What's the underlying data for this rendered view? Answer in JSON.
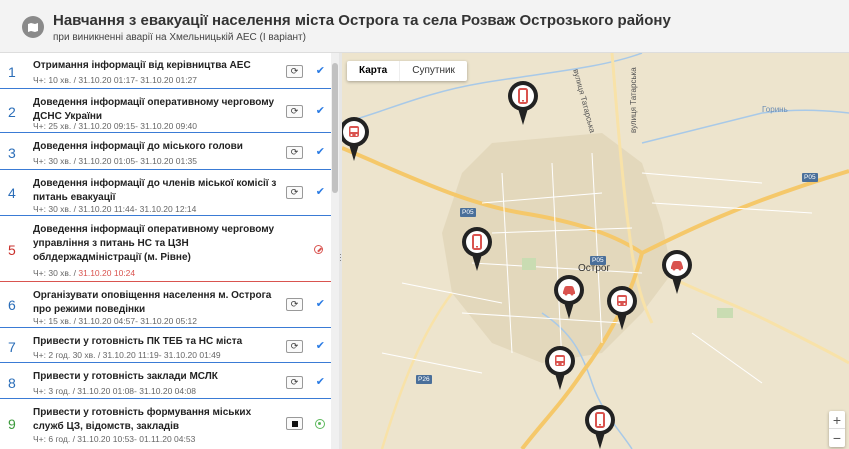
{
  "header": {
    "title": "Навчання з евакуації населення міста Острога та села Розваж Острозького району",
    "subtitle": "при виникненні аварії на Хмельницькій АЕС (І варіант)"
  },
  "tasks": [
    {
      "num": "1",
      "name": "Отримання інформації від керівництва АЕС",
      "meta": "Ч+: 10 хв. / 31.10.20 01:17- 31.10.20 01:27",
      "state": "done"
    },
    {
      "num": "2",
      "name": "Доведення інформації оперативному черговому ДСНС України",
      "meta": "Ч+: 25 хв. / 31.10.20 09:15- 31.10.20 09:40",
      "state": "done"
    },
    {
      "num": "3",
      "name": "Доведення інформації до міського голови",
      "meta": "Ч+: 30 хв. / 31.10.20 01:05- 31.10.20 01:35",
      "state": "done"
    },
    {
      "num": "4",
      "name": "Доведення інформації до членів міської комісії з питань евакуації",
      "meta": "Ч+: 30 хв. / 31.10.20 11:44- 31.10.20 12:14",
      "state": "done"
    },
    {
      "num": "5",
      "name": "Доведення інформації оперативному черговому управління з питань НС та ЦЗН облдержадміністрації (м. Рівне)",
      "meta": "Ч+: 30 хв. / ",
      "meta_late": "31.10.20 10:24",
      "state": "cancelled"
    },
    {
      "num": "6",
      "name": "Організувати оповіщення населення м. Острога про режими поведінки",
      "meta": "Ч+: 15 хв. / 31.10.20 04:57- 31.10.20 05:12",
      "state": "done"
    },
    {
      "num": "7",
      "name": "Привести у готовність ПК ТЕБ та НС міста",
      "meta": "Ч+: 2 год. 30 хв. / 31.10.20 11:19- 31.10.20 01:49",
      "state": "done"
    },
    {
      "num": "8",
      "name": "Привести у готовність заклади МСЛК",
      "meta": "Ч+: 3 год. / 31.10.20 01:08- 31.10.20 04:08",
      "state": "done"
    },
    {
      "num": "9",
      "name": "Привести у готовність формування міських служб ЦЗ, відомств, закладів",
      "meta": "Ч+: 6 год. / 31.10.20 10:53- 01.11.20 04:53",
      "state": "active"
    }
  ],
  "map": {
    "type_buttons": [
      "Карта",
      "Супутник"
    ],
    "active_type": "Карта",
    "city_label": "Острог",
    "street_labels": [
      "вулиця Татарська",
      "вулиця Татарська",
      "Горинь"
    ],
    "road_labels": [
      "P05",
      "P05",
      "P05",
      "P26"
    ],
    "zoom_in": "+",
    "zoom_out": "−"
  },
  "colors": {
    "accent": "#3a7bd5",
    "late": "#d9534f",
    "active": "#5cb85c",
    "map_bg": "#ede4cd",
    "road": "#f5c86a",
    "river": "#a8c9e8"
  },
  "icons": {
    "logo": "map-pins-icon",
    "refresh": "refresh-icon",
    "done": "check-icon",
    "cancelled": "ban-icon",
    "stop": "stop-icon",
    "active": "radio-dot-icon",
    "markers": [
      "phone-marker-icon",
      "bus-marker-icon",
      "phone-marker-icon",
      "car-marker-icon",
      "car-marker-icon",
      "bus-marker-icon",
      "bus-marker-icon",
      "phone-marker-icon"
    ]
  }
}
